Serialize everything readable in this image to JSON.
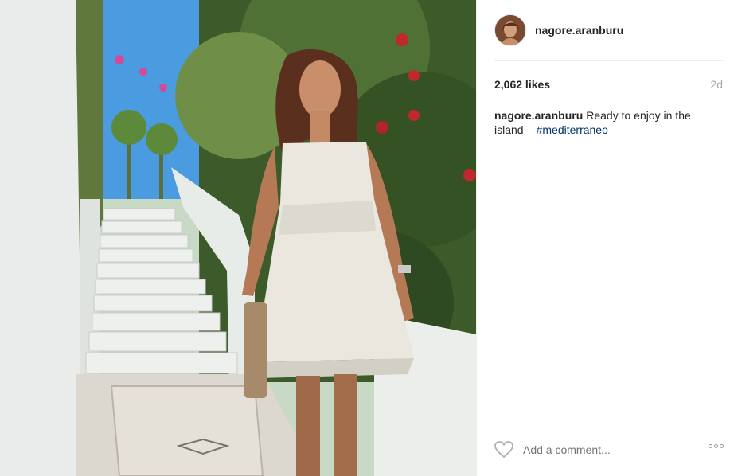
{
  "post": {
    "username": "nagore.aranburu",
    "likes_text": "2,062 likes",
    "age_text": "2d",
    "caption_username": "nagore.aranburu",
    "caption_text": "Ready to enjoy in the island",
    "hashtag": "#mediterraneo",
    "comment_placeholder": "Add a comment..."
  },
  "icons": {
    "like": "heart-outline-icon",
    "more": "more-options-icon"
  },
  "colors": {
    "hashtag": "#003569",
    "muted": "#a5a7aa",
    "text": "#262626"
  }
}
